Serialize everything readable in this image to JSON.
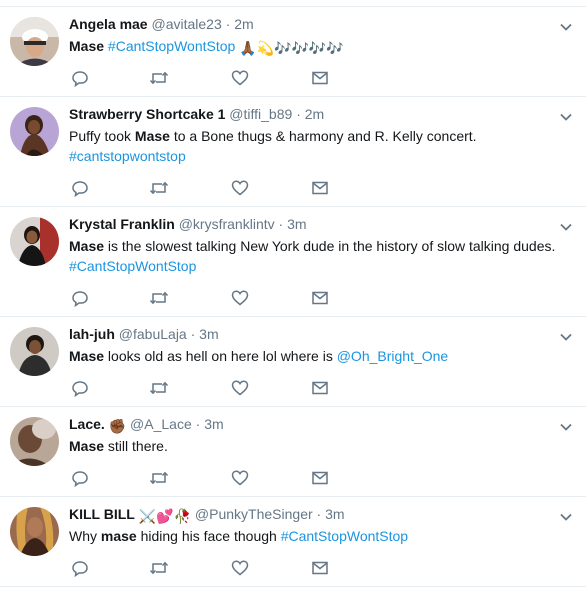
{
  "tweets": [
    {
      "fullname": "Angela mae",
      "username": "@avitale23",
      "dot": "·",
      "time": "2m",
      "bold": "Mase",
      "t1": " ",
      "link": "#CantStopWontStop",
      "tail": "",
      "emoji": "🙏🏾💫🎶🎶🎶🎶"
    },
    {
      "fullname": "Strawberry Shortcake 1",
      "username": "@tiffi_b89",
      "dot": "·",
      "time": "2m",
      "pre": "Puffy took ",
      "bold": "Mase",
      "t1": " to a Bone thugs & harmony and R. Kelly concert.",
      "link": "#cantstopwontstop"
    },
    {
      "fullname": "Krystal Franklin",
      "username": "@krysfranklintv",
      "dot": "·",
      "time": "3m",
      "bold": "Mase",
      "t1": " is the slowest talking New York dude in the history of slow talking dudes.",
      "link": "#CantStopWontStop"
    },
    {
      "fullname": "lah-juh",
      "username": "@fabuLaja",
      "dot": "·",
      "time": "3m",
      "bold": "Mase",
      "t1": " looks old as hell on here lol where is ",
      "link": "@Oh_Bright_One"
    },
    {
      "fullname": "Lace.",
      "name_emoji": "✊🏾",
      "username": "@A_Lace",
      "dot": "·",
      "time": "3m",
      "bold": "Mase",
      "t1": " still there."
    },
    {
      "fullname": "KILL BILL",
      "name_emoji": "⚔️💕🥀",
      "username": "@PunkyTheSinger",
      "dot": "·",
      "time": "3m",
      "pre": "Why ",
      "bold": "mase",
      "t1": " hiding his face though ",
      "link": "#CantStopWontStop"
    }
  ],
  "icons": {
    "reply": "reply-icon",
    "retweet": "retweet-icon",
    "like": "heart-icon",
    "dm": "envelope-icon",
    "caret": "chevron-down-icon"
  },
  "colors": {
    "name": "#14171a",
    "meta": "#657786",
    "link": "#1b95e0",
    "divider": "#e6ecf0"
  }
}
